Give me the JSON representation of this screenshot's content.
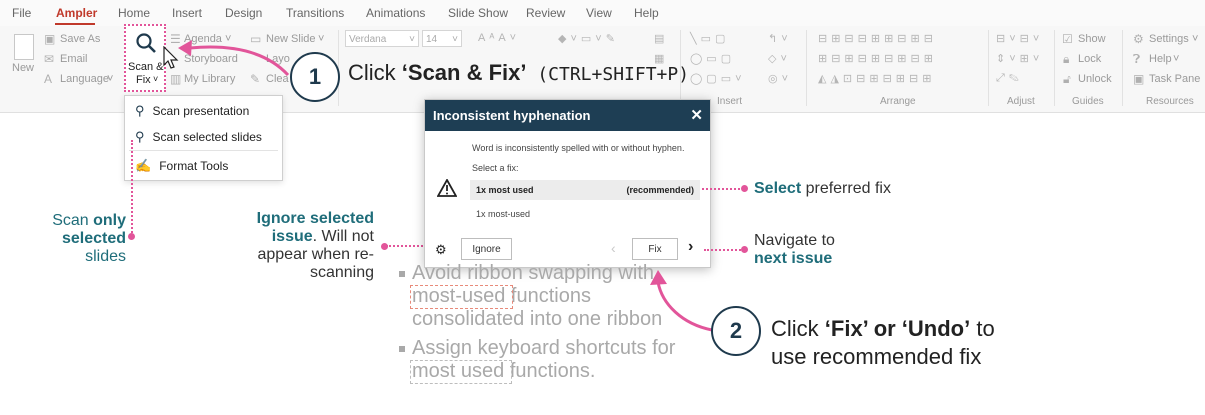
{
  "menubar": {
    "tabs": [
      "File",
      "Ampler",
      "Home",
      "Insert",
      "Design",
      "Transitions",
      "Animations",
      "Slide Show",
      "Review",
      "View",
      "Help"
    ]
  },
  "ribbon": {
    "new_label": "New",
    "save_as": "Save As",
    "email": "Email",
    "language": "Language",
    "scan_fix_line1": "Scan &",
    "scan_fix_line2": "Fix",
    "agenda": "Agenda",
    "storyboard": "Storyboard",
    "my_library": "My Library",
    "new_slide": "New Slide",
    "layouts": "Layo",
    "clean": "Clea",
    "font_name": "Verdana",
    "font_size": "14",
    "show": "Show",
    "lock": "Lock",
    "unlock": "Unlock",
    "settings": "Settings",
    "help": "Help",
    "task_pane": "Task Pane",
    "groups": {
      "insert": "Insert",
      "arrange": "Arrange",
      "adjust": "Adjust",
      "guides": "Guides",
      "resources": "Resources"
    }
  },
  "dropdown": {
    "items": [
      "Scan presentation",
      "Scan selected slides",
      "Format Tools"
    ]
  },
  "callout1": {
    "number": "1",
    "prefix": "Click ",
    "bold": "‘Scan & Fix’",
    "shortcut": " (CTRL+SHIFT+P)"
  },
  "callout2": {
    "number": "2",
    "prefix": "Click ",
    "bold": "‘Fix’ or ‘Undo’",
    "suffix": " to",
    "line2": "use recommended fix"
  },
  "annotations": {
    "scan_only": {
      "l1a": "Scan ",
      "l1b": "only",
      "l2a": "selected",
      "l2b": " slides"
    },
    "ignore": {
      "l1": "Ignore selected",
      "l2a": "issue",
      "l2b": ". Will not",
      "l3": "appear when re-",
      "l4": "scanning"
    },
    "select": {
      "bold": "Select",
      "rest": " preferred fix"
    },
    "navigate": {
      "l1": "Navigate to",
      "l2": "next issue"
    }
  },
  "dialog": {
    "title": "Inconsistent hyphenation",
    "close": "✕",
    "message": "Word is inconsistently spelled with or without hyphen.",
    "select_prompt": "Select a fix:",
    "fix_option_1": "1x most used",
    "recommended": "(recommended)",
    "fix_option_2": "1x most-used",
    "ignore_button": "Ignore",
    "fix_button": "Fix"
  },
  "slide": {
    "bullet1": [
      "Avoid ribbon swapping with",
      "most-used functions",
      "consolidated into one ribbon"
    ],
    "bullet2": [
      "Assign keyboard shortcuts for",
      "most used functions."
    ]
  },
  "colors": {
    "accent_pink": "#e2559a",
    "dialog_header": "#1e3e54",
    "annotation_teal": "#1f6d7a",
    "active_tab": "#c0392b"
  }
}
